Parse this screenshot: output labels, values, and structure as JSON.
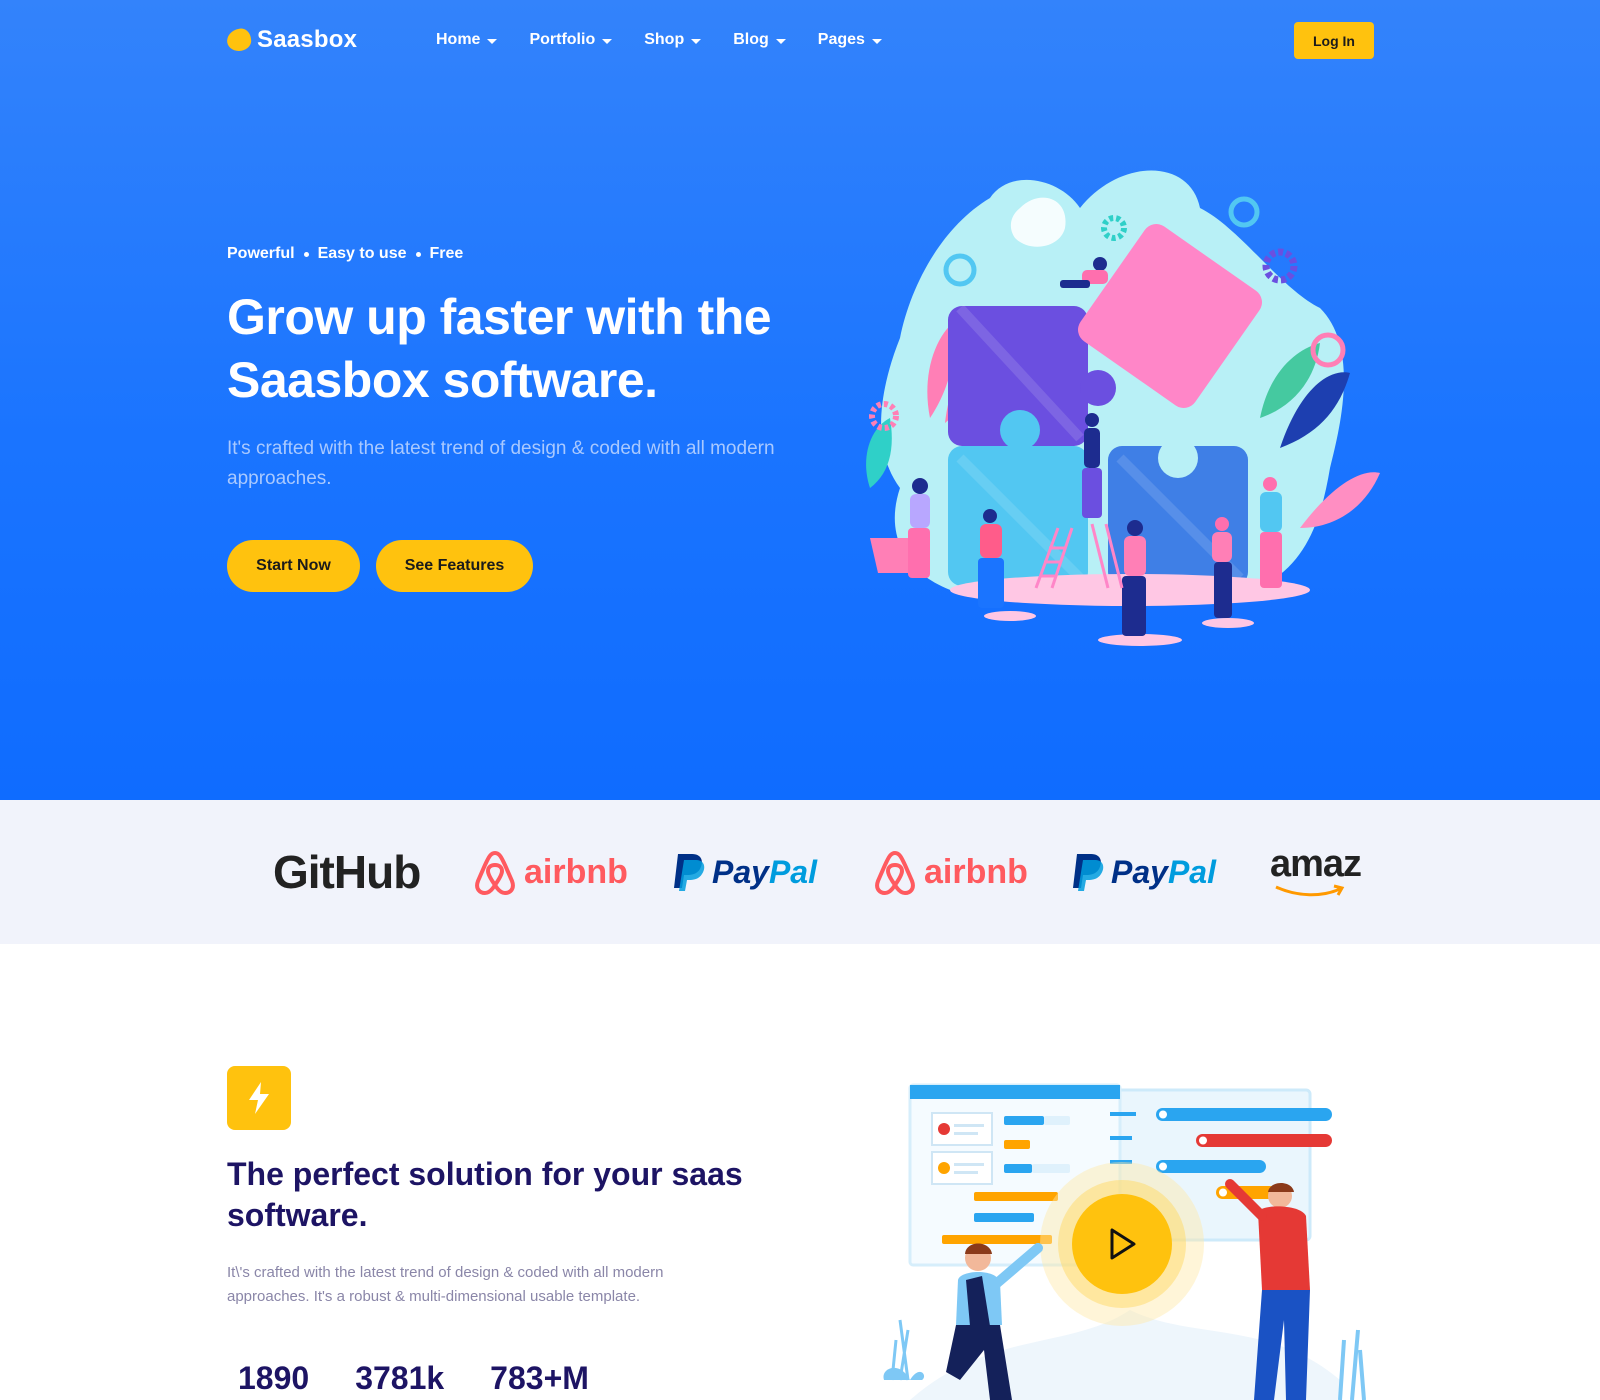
{
  "header": {
    "brand": "Saasbox",
    "menu": [
      {
        "label": "Home"
      },
      {
        "label": "Portfolio"
      },
      {
        "label": "Shop"
      },
      {
        "label": "Blog"
      },
      {
        "label": "Pages"
      }
    ],
    "login_label": "Log In"
  },
  "hero": {
    "tags": [
      "Powerful",
      "Easy to use",
      "Free"
    ],
    "title_line1": "Grow up faster with the",
    "title_line2": "Saasbox software.",
    "subtitle": "It's crafted with the latest trend of design & coded with all modern approaches.",
    "primary_cta": "Start Now",
    "secondary_cta": "See Features"
  },
  "brands": {
    "github": "GitHub",
    "airbnb": "airbnb",
    "paypal_pay": "Pay",
    "paypal_pal": "Pal",
    "amazon": "amaz"
  },
  "solution": {
    "icon": "bolt-icon",
    "title": "The perfect solution for your saas software.",
    "description": "It\\'s crafted with the latest trend of design & coded with all modern approaches. It's a robust & multi-dimensional usable template.",
    "stats": [
      "1890",
      "3781k",
      "783+M"
    ],
    "play_icon": "play-icon"
  },
  "colors": {
    "hero_blue": "#1a74ff",
    "accent_yellow": "#ffc20e",
    "heading_navy": "#1d1464",
    "brand_strip": "#f1f3fb",
    "airbnb": "#ff5a5f",
    "paypal_dark": "#003087",
    "paypal_light": "#009cde"
  }
}
